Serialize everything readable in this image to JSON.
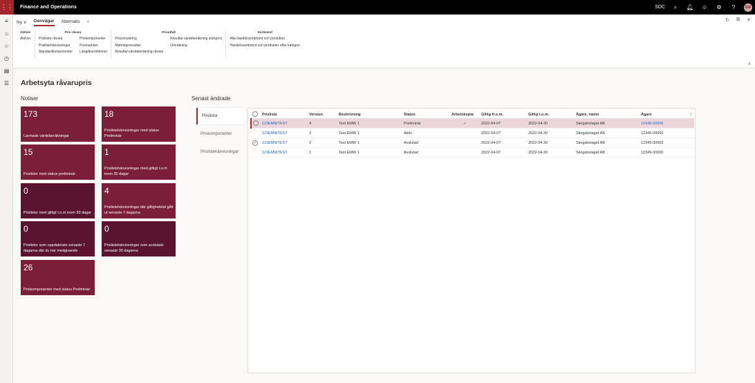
{
  "topbar": {
    "app_title": "Finance and Operations",
    "company": "SDC",
    "avatar_initials": "EW",
    "icons": [
      "waffle-icon",
      "search-icon",
      "notifications-icon",
      "smiley-icon",
      "gear-icon",
      "help-icon"
    ]
  },
  "leftnav": {
    "icons": [
      "hamburger-icon",
      "home-icon",
      "star-icon",
      "clock-icon",
      "workspace-icon",
      "list-icon"
    ]
  },
  "actionpane": {
    "new_label": "Ny",
    "tabs": [
      "Genvägar",
      "Alternativ"
    ],
    "groups": {
      "aktiver": {
        "title": "Aktiver",
        "items": [
          "Aktiver"
        ]
      },
      "pris_ravara": {
        "title": "Pris råvara",
        "col1": [
          "Prislistor råvara",
          "Prislistehänvisningar",
          "Standardkomponenter"
        ],
        "col2": [
          "Priskomponenter",
          "Prismatriser",
          "Längdkorrektioner"
        ]
      },
      "prisutfall": {
        "title": "Prisutfall",
        "col1": [
          "Prissimulering",
          "Mätningsresultat",
          "Resultat värdeberäkning råvara"
        ],
        "col2": [
          "Resultat värdeberäkning stickprov",
          "Omräkning"
        ]
      },
      "sortiment": {
        "title": "Sortiment",
        "items": [
          "Alla handelssortiment och produkter",
          "Handelssortiment och produkter efter kategori"
        ]
      }
    }
  },
  "workspace": {
    "title": "Arbetsyta råvarupris",
    "notices_header": "Notiser",
    "recent_header": "Senast ändrade",
    "tiles": [
      {
        "count": "173",
        "label": "Larmade värdeberäkningar"
      },
      {
        "count": "18",
        "label": "Prislistehänvisningar med status Preliminär"
      },
      {
        "count": "15",
        "label": "Prislistor med status preliminär"
      },
      {
        "count": "1",
        "label": "Prislistehänvisningar med giltigt t.o.m inom 30 dagar"
      },
      {
        "count": "0",
        "label": "Prislistor med giltigt t.o.m inom 30 dagar"
      },
      {
        "count": "4",
        "label": "Prislistehänvisningar där giltighetstid gått ut senaste 7 dagarna"
      },
      {
        "count": "0",
        "label": "Prislistor som uppdaterats senaste 7 dagarna där du har medgivande"
      },
      {
        "count": "0",
        "label": "Prislistehänvisningar som avslutats senaste 30 dagarna"
      },
      {
        "count": "26",
        "label": "Priskomponenter med status Preliminär"
      }
    ],
    "list_tabs": [
      "Prislistor",
      "Priskomponenter",
      "Prislistehänvisningar"
    ],
    "grid": {
      "columns": [
        "Prislista",
        "Version",
        "Beskrivning",
        "Status",
        "Arbetskopia",
        "Giltig fr.o.m.",
        "Giltig t.o.m.",
        "Ägare, namn",
        "Ägare"
      ],
      "rows": [
        {
          "prislista": "123EMWTEST",
          "version": "4",
          "beskrivning": "Test EMW 1",
          "status": "Preliminär",
          "arbetskopia": "✓",
          "from": "2022-04-07",
          "tom": "2022-04-30",
          "agare_namn": "Skogsbolaget AB",
          "agare": "12345-00000"
        },
        {
          "prislista": "123EMWTEST",
          "version": "3",
          "beskrivning": "Test EMW 1",
          "status": "Aktiv",
          "arbetskopia": "",
          "from": "2022-04-07",
          "tom": "2022-04-30",
          "agare_namn": "Skogsbolaget AB",
          "agare": "12345-00000"
        },
        {
          "prislista": "123EMWTEST",
          "version": "2",
          "beskrivning": "Test EMW 1",
          "status": "Avslutad",
          "arbetskopia": "",
          "from": "2022-04-07",
          "tom": "2022-04-30",
          "agare_namn": "Skogsbolaget AB",
          "agare": "12345-00000"
        },
        {
          "prislista": "123EMWTEST",
          "version": "1",
          "beskrivning": "Test EMW 1",
          "status": "Avslutad",
          "arbetskopia": "",
          "from": "2022-04-07",
          "tom": "2022-04-30",
          "agare_namn": "Skogsbolaget AB",
          "agare": "12345-00000"
        }
      ]
    }
  }
}
